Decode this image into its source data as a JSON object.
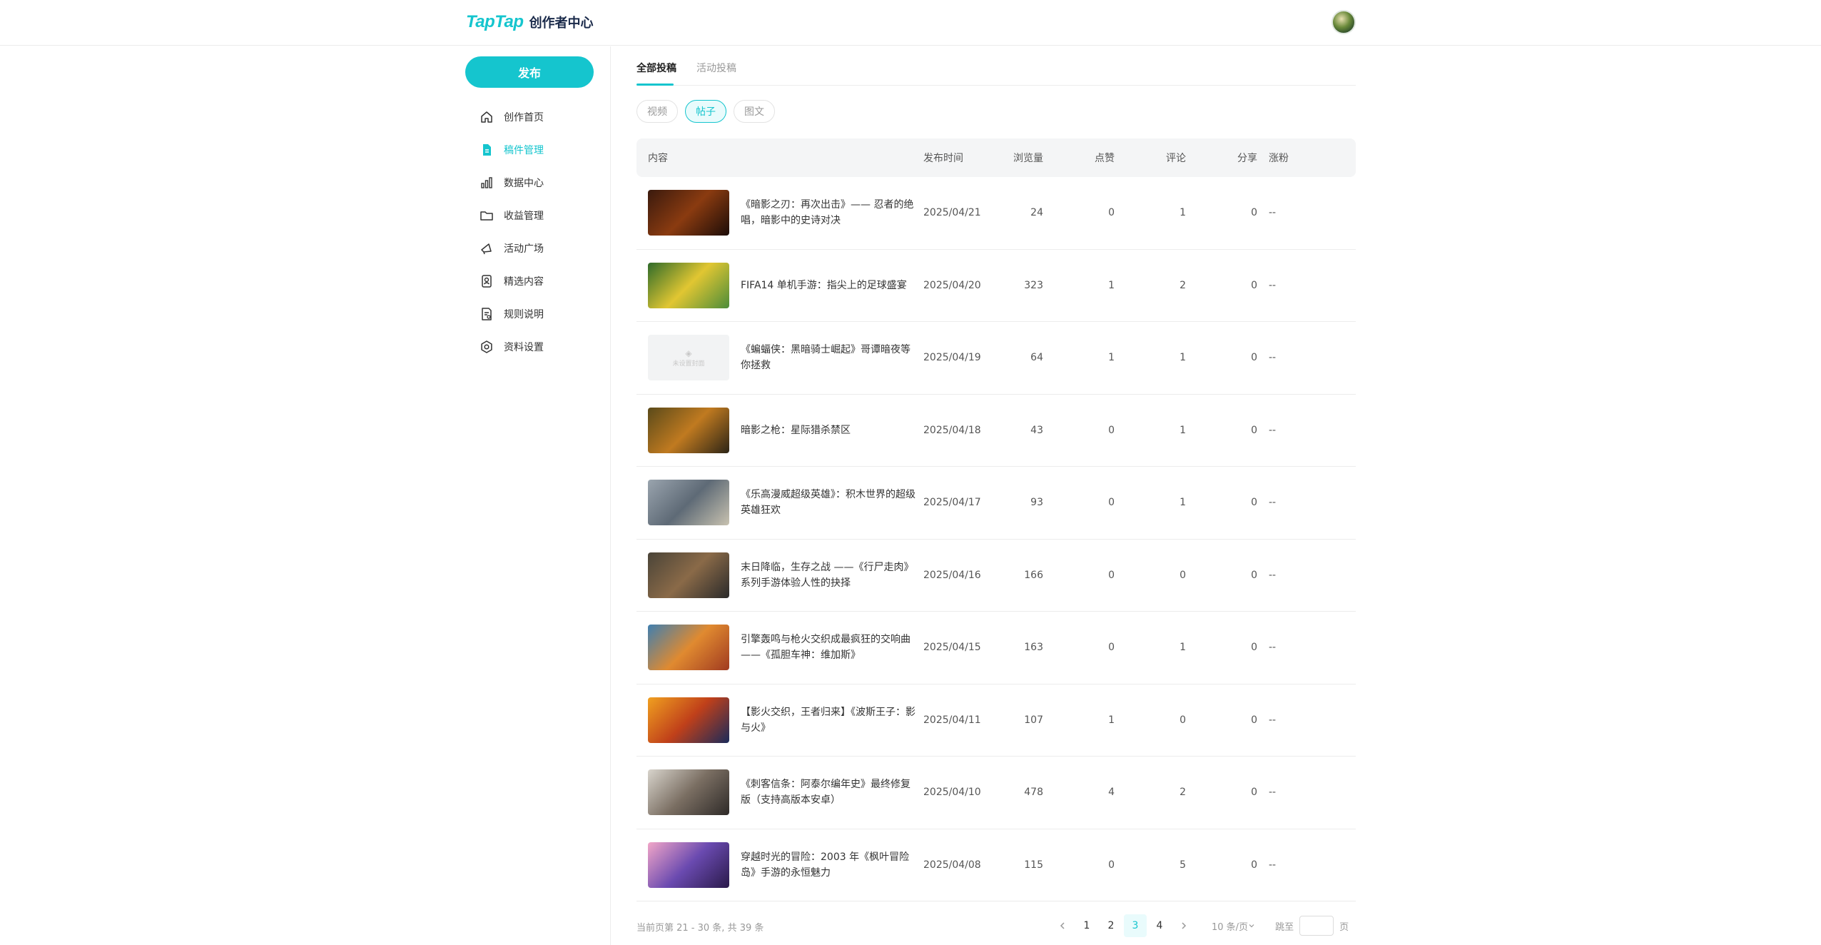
{
  "header": {
    "logo_main": "TapTap",
    "logo_sub": "创作者中心"
  },
  "sidebar": {
    "publish_label": "发布",
    "items": [
      {
        "label": "创作首页",
        "icon": "home-icon",
        "active": false
      },
      {
        "label": "稿件管理",
        "icon": "document-icon",
        "active": true
      },
      {
        "label": "数据中心",
        "icon": "bar-chart-icon",
        "active": false
      },
      {
        "label": "收益管理",
        "icon": "folder-icon",
        "active": false
      },
      {
        "label": "活动广场",
        "icon": "megaphone-icon",
        "active": false
      },
      {
        "label": "精选内容",
        "icon": "badge-icon",
        "active": false
      },
      {
        "label": "规则说明",
        "icon": "rules-icon",
        "active": false
      },
      {
        "label": "资料设置",
        "icon": "settings-icon",
        "active": false
      }
    ]
  },
  "tabs": [
    {
      "label": "全部投稿",
      "active": true
    },
    {
      "label": "活动投稿",
      "active": false
    }
  ],
  "chips": [
    {
      "label": "视频",
      "active": false
    },
    {
      "label": "帖子",
      "active": true
    },
    {
      "label": "图文",
      "active": false
    }
  ],
  "table": {
    "headers": {
      "content": "内容",
      "date": "发布时间",
      "views": "浏览量",
      "likes": "点赞",
      "comments": "评论",
      "shares": "分享",
      "fans": "涨粉"
    },
    "rows": [
      {
        "title": "《暗影之刃：再次出击》—— 忍者的绝唱，暗影中的史诗对决",
        "date": "2025/04/21",
        "views": "24",
        "likes": "0",
        "comments": "1",
        "shares": "0",
        "fans": "--",
        "thumb": [
          "#3a1a0e",
          "#8a3b10",
          "#1c0c08"
        ]
      },
      {
        "title": "FIFA14 单机手游：指尖上的足球盛宴",
        "date": "2025/04/20",
        "views": "323",
        "likes": "1",
        "comments": "2",
        "shares": "0",
        "fans": "--",
        "thumb": [
          "#2f6b2a",
          "#e1c632",
          "#4c8c3a"
        ]
      },
      {
        "title": "《蝙蝠侠：黑暗骑士崛起》哥谭暗夜等你拯救",
        "date": "2025/04/19",
        "views": "64",
        "likes": "1",
        "comments": "1",
        "shares": "0",
        "fans": "--",
        "thumb": null,
        "thumb_text": "未设置封面"
      },
      {
        "title": "暗影之枪：星际猎杀禁区",
        "date": "2025/04/18",
        "views": "43",
        "likes": "0",
        "comments": "1",
        "shares": "0",
        "fans": "--",
        "thumb": [
          "#5a4a1a",
          "#c07a20",
          "#2c2416"
        ]
      },
      {
        "title": "《乐高漫威超级英雄》：积木世界的超级英雄狂欢",
        "date": "2025/04/17",
        "views": "93",
        "likes": "0",
        "comments": "1",
        "shares": "0",
        "fans": "--",
        "thumb": [
          "#9aa4ae",
          "#5e6a76",
          "#c8c2b0"
        ]
      },
      {
        "title": "末日降临，生存之战 ——《行尸走肉》系列手游体验人性的抉择",
        "date": "2025/04/16",
        "views": "166",
        "likes": "0",
        "comments": "0",
        "shares": "0",
        "fans": "--",
        "thumb": [
          "#4a4438",
          "#8a6a48",
          "#2a2a2a"
        ]
      },
      {
        "title": "引擎轰鸣与枪火交织成最疯狂的交响曲 ——《孤胆车神：维加斯》",
        "date": "2025/04/15",
        "views": "163",
        "likes": "0",
        "comments": "1",
        "shares": "0",
        "fans": "--",
        "thumb": [
          "#3f7fb0",
          "#e08a30",
          "#a03a20"
        ]
      },
      {
        "title": "【影火交织，王者归来】《波斯王子：影与火》",
        "date": "2025/04/11",
        "views": "107",
        "likes": "1",
        "comments": "0",
        "shares": "0",
        "fans": "--",
        "thumb": [
          "#f0a020",
          "#c0401a",
          "#1a2a5a"
        ]
      },
      {
        "title": "《刺客信条：阿泰尔编年史》最终修复版（支持高版本安卓）",
        "date": "2025/04/10",
        "views": "478",
        "likes": "4",
        "comments": "2",
        "shares": "0",
        "fans": "--",
        "thumb": [
          "#d8d4cc",
          "#7a6e62",
          "#2e2a28"
        ]
      },
      {
        "title": "穿越时光的冒险：2003 年《枫叶冒险岛》手游的永恒魅力",
        "date": "2025/04/08",
        "views": "115",
        "likes": "0",
        "comments": "5",
        "shares": "0",
        "fans": "--",
        "thumb": [
          "#f2a6c8",
          "#6a4ab0",
          "#2a1a4a"
        ]
      }
    ]
  },
  "footer": {
    "total_text": "当前页第 21 - 30 条, 共 39 条",
    "pages": [
      "1",
      "2",
      "3",
      "4"
    ],
    "current_page": "3",
    "page_size": "10 条/页",
    "jump_label": "跳至",
    "jump_suffix": "页"
  },
  "colors": {
    "accent": "#15c5ce",
    "accent_light": "#e9fbfc"
  }
}
